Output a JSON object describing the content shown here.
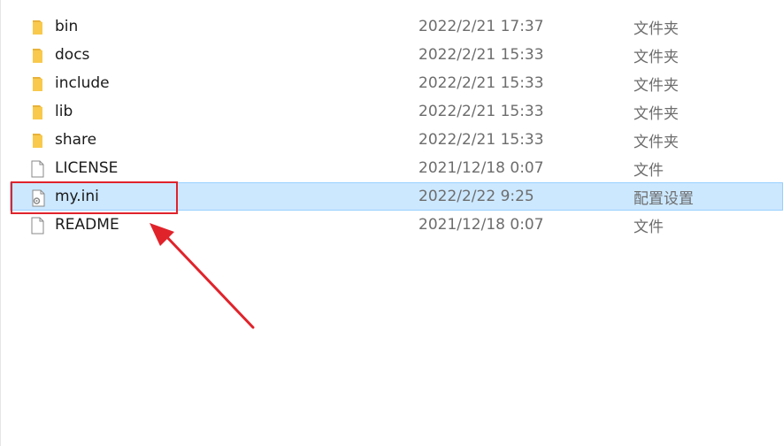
{
  "files": [
    {
      "name": "bin",
      "date": "2022/2/21 17:37",
      "type": "文件夹",
      "icon": "folder-icon"
    },
    {
      "name": "docs",
      "date": "2022/2/21 15:33",
      "type": "文件夹",
      "icon": "folder-icon"
    },
    {
      "name": "include",
      "date": "2022/2/21 15:33",
      "type": "文件夹",
      "icon": "folder-icon"
    },
    {
      "name": "lib",
      "date": "2022/2/21 15:33",
      "type": "文件夹",
      "icon": "folder-icon"
    },
    {
      "name": "share",
      "date": "2022/2/21 15:33",
      "type": "文件夹",
      "icon": "folder-icon"
    },
    {
      "name": "LICENSE",
      "date": "2021/12/18 0:07",
      "type": "文件",
      "icon": "file-icon"
    },
    {
      "name": "my.ini",
      "date": "2022/2/22 9:25",
      "type": "配置设置",
      "icon": "config-file-icon",
      "selected": true
    },
    {
      "name": "README",
      "date": "2021/12/18 0:07",
      "type": "文件",
      "icon": "file-icon"
    }
  ],
  "annotation": {
    "color": "#e0232b",
    "box_target": "my.ini",
    "arrow": "pointing-up-left"
  },
  "colors": {
    "selection_bg": "#cce8ff",
    "selection_border": "#99d1ff",
    "folder": "#f8c94c"
  }
}
